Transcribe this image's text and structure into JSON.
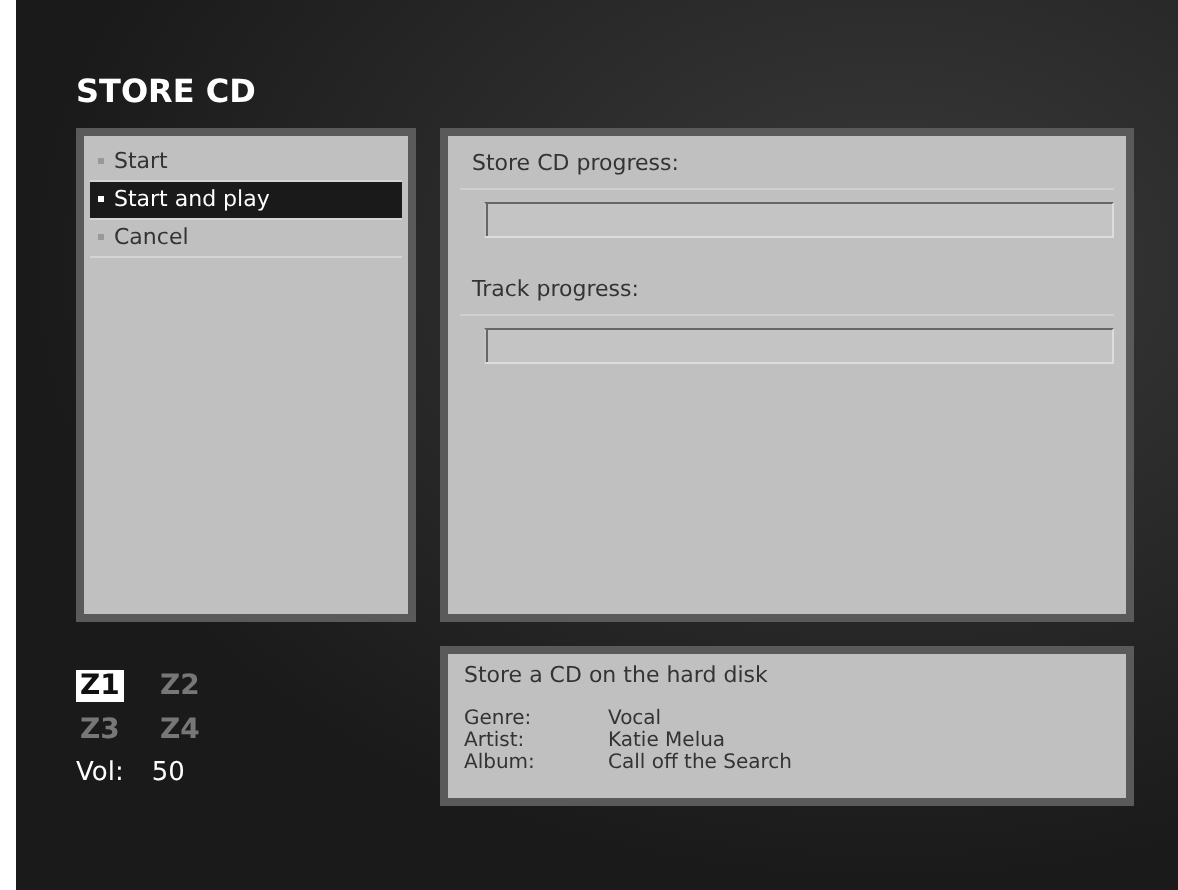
{
  "title": "STORE CD",
  "menu": [
    {
      "label": "Start",
      "selected": false
    },
    {
      "label": "Start and play",
      "selected": true
    },
    {
      "label": "Cancel",
      "selected": false
    }
  ],
  "progress": [
    {
      "label": "Store CD progress:",
      "level": 0
    },
    {
      "label": "Track progress:",
      "level": 0
    }
  ],
  "zones": [
    {
      "label": "Z1",
      "selected": true
    },
    {
      "label": "Z2",
      "selected": false
    },
    {
      "label": "Z3",
      "selected": false
    },
    {
      "label": "Z4",
      "selected": false
    }
  ],
  "volume": {
    "label": "Vol:",
    "value": "50"
  },
  "info": {
    "description": "Store a CD on the hard disk",
    "fields": [
      {
        "label": "Genre:",
        "value": "Vocal"
      },
      {
        "label": "Artist:",
        "value": "Katie Melua"
      },
      {
        "label": "Album:",
        "value": "Call off the Search"
      }
    ]
  }
}
